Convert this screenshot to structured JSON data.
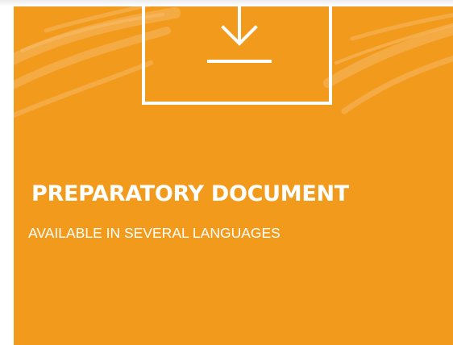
{
  "card": {
    "title": "PREPARATORY DOCUMENT",
    "subtitle": "AVAILABLE IN SEVERAL LANGUAGES",
    "icon": "download-icon"
  },
  "colors": {
    "background": "#ffffff",
    "card": "#f29a1c",
    "foreground": "#ffffff"
  }
}
